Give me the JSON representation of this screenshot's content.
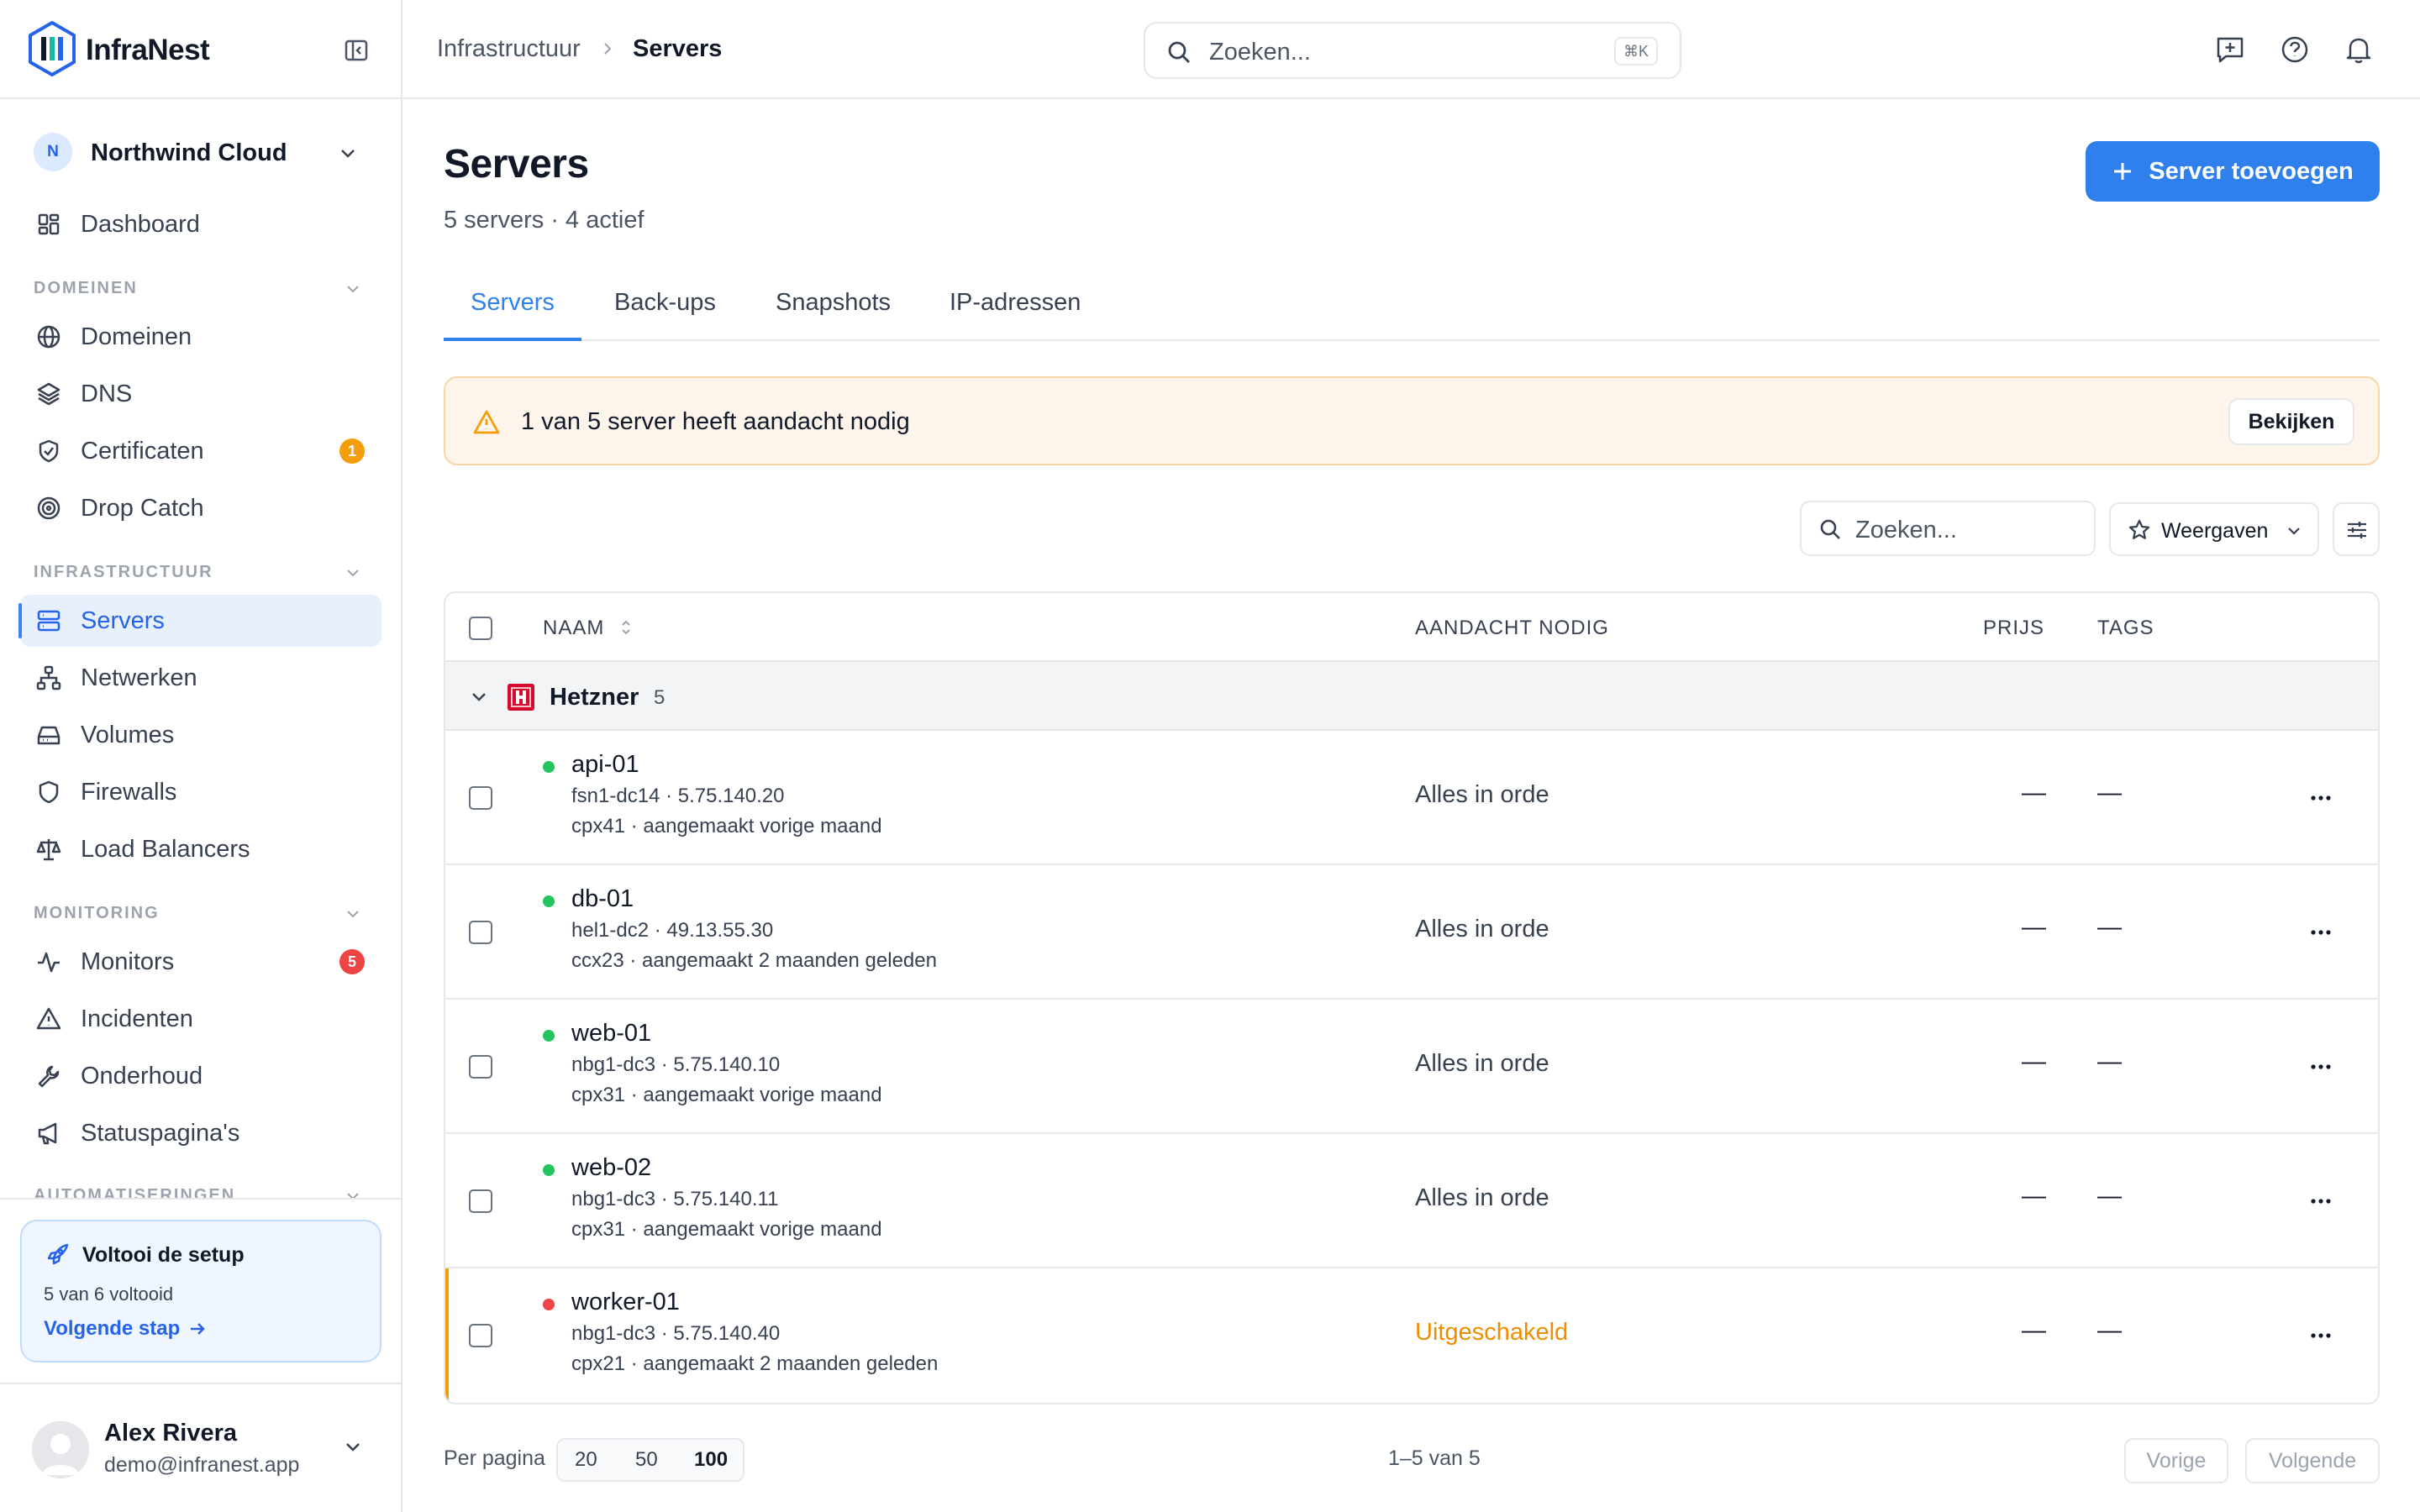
{
  "app": {
    "brand": "InfraNest"
  },
  "workspace": {
    "initial": "N",
    "name": "Northwind Cloud"
  },
  "sidebar": {
    "dashboard": "Dashboard",
    "sections": {
      "domeinen": "DOMEINEN",
      "infrastructuur": "INFRASTRUCTUUR",
      "monitoring": "MONITORING",
      "automatiseringen": "AUTOMATISERINGEN"
    },
    "items": {
      "domeinen": "Domeinen",
      "dns": "DNS",
      "certificaten": "Certificaten",
      "certificaten_badge": "1",
      "drop_catch": "Drop Catch",
      "servers": "Servers",
      "netwerken": "Netwerken",
      "volumes": "Volumes",
      "firewalls": "Firewalls",
      "load_balancers": "Load Balancers",
      "monitors": "Monitors",
      "monitors_badge": "5",
      "incidenten": "Incidenten",
      "onderhoud": "Onderhoud",
      "statuspaginas": "Statuspagina's"
    },
    "setup": {
      "title": "Voltooi de setup",
      "progress": "5 van 6 voltooid",
      "next": "Volgende stap"
    },
    "user": {
      "name": "Alex Rivera",
      "email": "demo@infranest.app"
    }
  },
  "topbar": {
    "breadcrumb": [
      "Infrastructuur",
      "Servers"
    ],
    "search_placeholder": "Zoeken...",
    "search_shortcut": "⌘K"
  },
  "page": {
    "title": "Servers",
    "subtitle": "5 servers · 4 actief",
    "add_button": "Server toevoegen",
    "tabs": [
      "Servers",
      "Back-ups",
      "Snapshots",
      "IP-adressen"
    ],
    "active_tab": "Servers"
  },
  "alert": {
    "text": "1 van 5 server heeft aandacht nodig",
    "button": "Bekijken"
  },
  "toolbar": {
    "search_placeholder": "Zoeken...",
    "views_label": "Weergaven"
  },
  "table": {
    "columns": {
      "name": "NAAM",
      "attention": "AANDACHT NODIG",
      "price": "PRIJS",
      "tags": "TAGS"
    },
    "group": {
      "name": "Hetzner",
      "count": "5"
    },
    "rows": [
      {
        "name": "api-01",
        "location": "fsn1-dc14 · 5.75.140.20",
        "meta": "cpx41 · aangemaakt vorige maand",
        "status": "Alles in orde",
        "status_color": "#22c55e",
        "price": "—",
        "tags": "—"
      },
      {
        "name": "db-01",
        "location": "hel1-dc2 · 49.13.55.30",
        "meta": "ccx23 · aangemaakt 2 maanden geleden",
        "status": "Alles in orde",
        "status_color": "#22c55e",
        "price": "—",
        "tags": "—"
      },
      {
        "name": "web-01",
        "location": "nbg1-dc3 · 5.75.140.10",
        "meta": "cpx31 · aangemaakt vorige maand",
        "status": "Alles in orde",
        "status_color": "#22c55e",
        "price": "—",
        "tags": "—"
      },
      {
        "name": "web-02",
        "location": "nbg1-dc3 · 5.75.140.11",
        "meta": "cpx31 · aangemaakt vorige maand",
        "status": "Alles in orde",
        "status_color": "#22c55e",
        "price": "—",
        "tags": "—"
      },
      {
        "name": "worker-01",
        "location": "nbg1-dc3 · 5.75.140.40",
        "meta": "cpx21 · aangemaakt 2 maanden geleden",
        "status": "Uitgeschakeld",
        "status_color": "#ef4444",
        "price": "—",
        "tags": "—"
      }
    ]
  },
  "pagination": {
    "per_page_label": "Per pagina",
    "sizes": [
      "20",
      "50",
      "100"
    ],
    "selected_size": "100",
    "range": "1–5 van 5",
    "prev": "Vorige",
    "next": "Volgende"
  },
  "colors": {
    "accent": "#2f80ed",
    "ok": "#22c55e",
    "error": "#ef4444",
    "warning": "#f59e0b",
    "warning_text": "#f08c00"
  }
}
